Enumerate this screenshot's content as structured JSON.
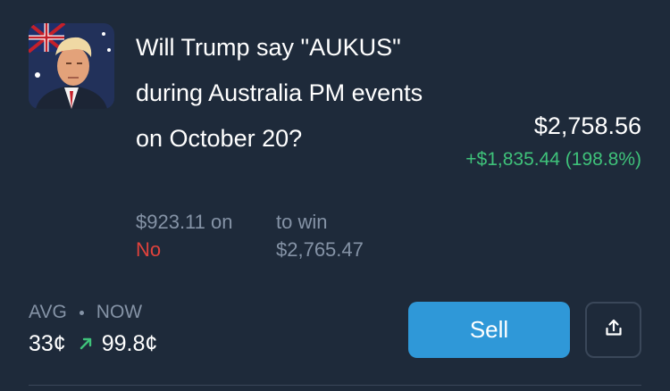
{
  "position": {
    "thumbnail_icon": "market-thumbnail",
    "title": "Will Trump say \"AUKUS\" during Australia PM events on October 20?",
    "current_value": "$2,758.56",
    "change": "+$1,835.44 (198.8%)",
    "bet_amount": "$923.11 on",
    "bet_side": "No",
    "to_win_label": "to win",
    "to_win_value": "$2,765.47",
    "avg_label": "AVG",
    "now_label": "NOW",
    "avg_price": "33¢",
    "now_price": "99.8¢",
    "sell_label": "Sell",
    "share_icon": "share-icon"
  },
  "colors": {
    "background": "#1e2a3a",
    "positive": "#3fc27a",
    "negative": "#e0423c",
    "muted": "#8593a6",
    "accent": "#2f98d8"
  }
}
